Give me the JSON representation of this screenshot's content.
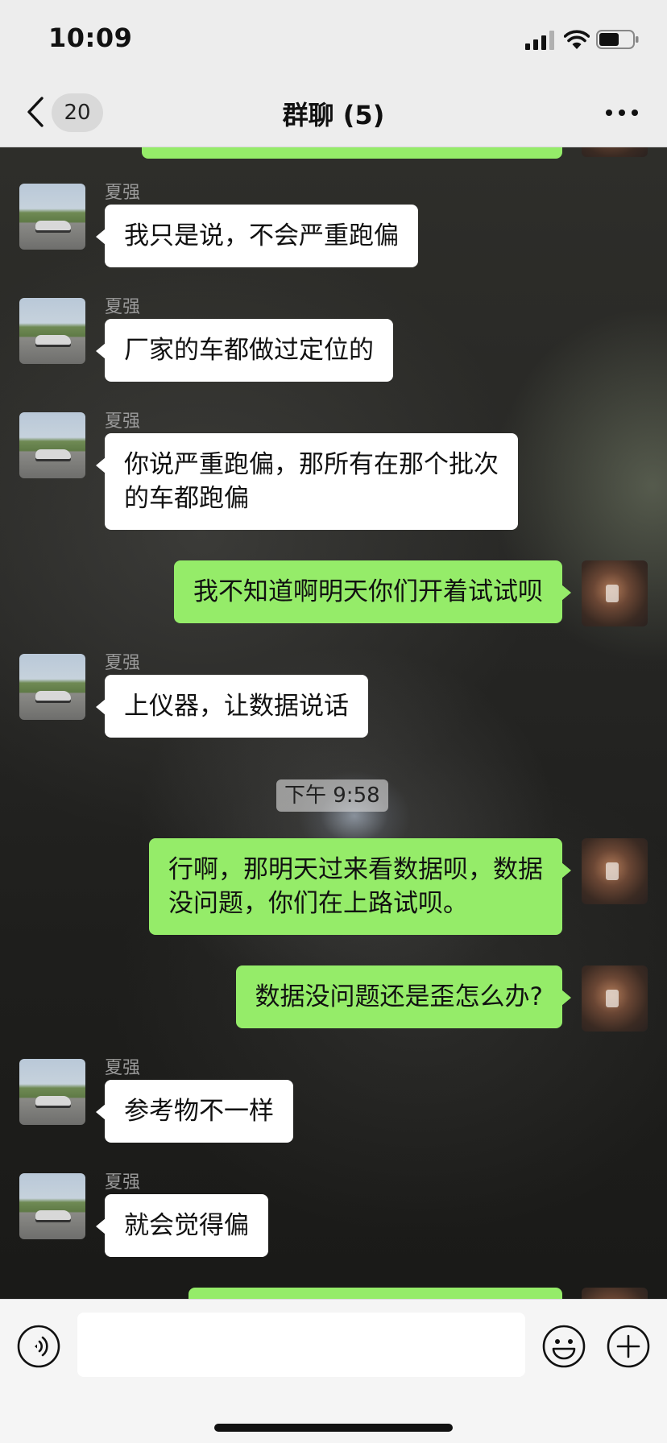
{
  "status_bar": {
    "time": "10:09"
  },
  "nav": {
    "badge": "20",
    "title": "群聊 (5)"
  },
  "sender": {
    "name": "夏强"
  },
  "messages": [
    {
      "side": "out",
      "text": ""
    },
    {
      "side": "in",
      "sender": "夏强",
      "text": "我只是说，不会严重跑偏"
    },
    {
      "side": "in",
      "sender": "夏强",
      "text": "厂家的车都做过定位的"
    },
    {
      "side": "in",
      "sender": "夏强",
      "lines": [
        "你说严重跑偏，那所有在那个批次",
        "的车都跑偏"
      ]
    },
    {
      "side": "out",
      "text": "我不知道啊明天你们开着试试呗"
    },
    {
      "side": "in",
      "sender": "夏强",
      "text": "上仪器，让数据说话"
    },
    {
      "type": "time",
      "text": "下午 9:58"
    },
    {
      "side": "out",
      "lines": [
        "行啊，那明天过来看数据呗，数据",
        "没问题，你们在上路试呗。"
      ]
    },
    {
      "side": "out",
      "text": "数据没问题还是歪怎么办?"
    },
    {
      "side": "in",
      "sender": "夏强",
      "text": "参考物不一样"
    },
    {
      "side": "in",
      "sender": "夏强",
      "text": "就会觉得偏"
    },
    {
      "side": "out",
      "text": ""
    }
  ],
  "input": {
    "value": "",
    "placeholder": ""
  },
  "icons": {
    "back": "chevron-left-icon",
    "more": "more-dots-icon",
    "voice": "voice-icon",
    "emoji": "emoji-icon",
    "plus": "plus-icon"
  },
  "colors": {
    "outgoing_bubble": "#95ec69",
    "incoming_bubble": "#ffffff",
    "bar_bg": "#ededed"
  }
}
